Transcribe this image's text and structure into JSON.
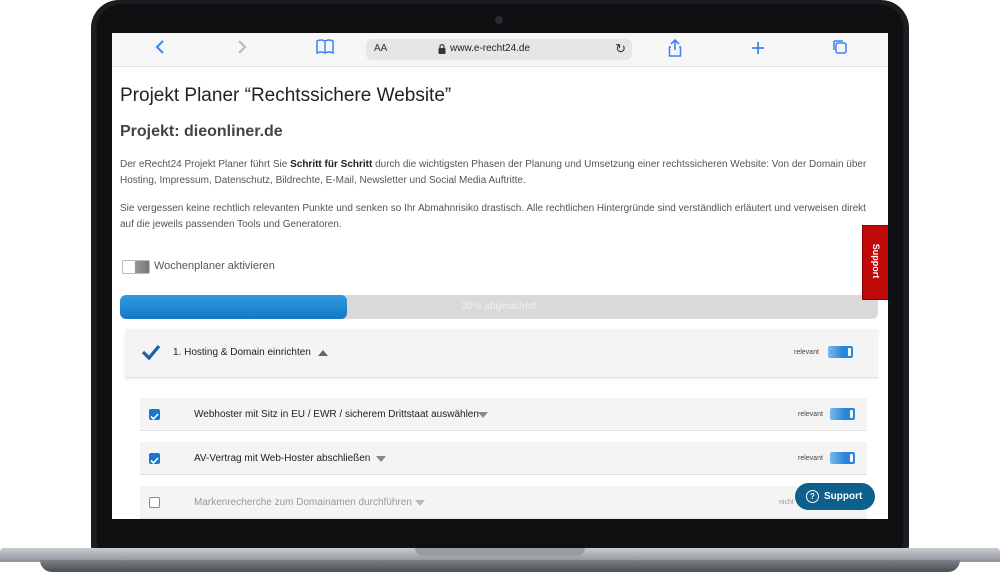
{
  "browser": {
    "url_text": "www.e-recht24.de",
    "aa_label": "AA",
    "icons": [
      "chevron-left-icon",
      "chevron-right-icon",
      "book-icon",
      "lock-icon",
      "reload-icon",
      "share-icon",
      "plus-icon",
      "tabs-icon"
    ]
  },
  "page": {
    "title": "Projekt Planer “Rechtssichere Website”",
    "project": "Projekt: dieonliner.de",
    "intro_pre": "Der eRecht24 Projekt Planer führt Sie ",
    "intro_bold": "Schritt für Schritt",
    "intro_post": " durch die wichtigsten Phasen der Planung und Umsetzung einer rechtssicheren Website: Von der Domain über Hosting, Impressum, Datenschutz, Bildrechte, E-Mail, Newsletter und Social Media Auftritte.",
    "intro2": "Sie vergessen keine rechtlich relevanten Punkte und senken so Ihr Abmahnrisiko drastisch. Alle rechtlichen Hintergründe sind verständlich erläutert und verweisen direkt auf die jeweils passenden Tools und Generatoren."
  },
  "weekly_planner": {
    "label": "Wochenplaner aktivieren",
    "enabled": false
  },
  "progress": {
    "label": "30% abgesichert",
    "fraction": 0.3
  },
  "section": {
    "title": "1. Hosting & Domain einrichten",
    "relevant_label": "relevant",
    "checked": true
  },
  "items": [
    {
      "title": "Webhoster mit Sitz in EU / EWR / sicherem Drittstaat auswählen",
      "relevant_label": "relevant",
      "checked": true
    },
    {
      "title": "AV-Vertrag mit Web-Hoster abschließen",
      "relevant_label": "relevant",
      "checked": true
    },
    {
      "title": "Markenrecherche zum Domainamen durchführen",
      "relevant_label": "nicht",
      "checked": false
    }
  ],
  "support": {
    "tab_label": "Support",
    "button_label": "Support"
  },
  "colors": {
    "accent": "#1677d2",
    "support_red": "#c00a0a",
    "support_blue": "#0d5f8c"
  }
}
